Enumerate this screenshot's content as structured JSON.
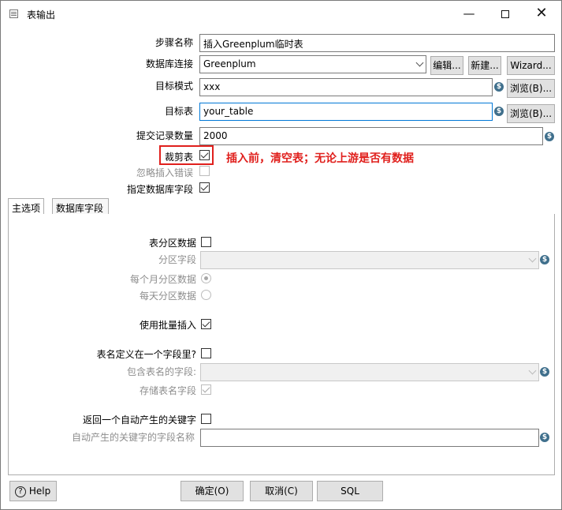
{
  "window": {
    "title": "表输出"
  },
  "form": {
    "step_name_label": "步骤名称",
    "step_name_value": "插入Greenplum临时表",
    "db_conn_label": "数据库连接",
    "db_conn_value": "Greenplum",
    "edit_btn": "编辑...",
    "new_btn": "新建...",
    "wizard_btn": "Wizard...",
    "schema_label": "目标模式",
    "schema_value": "xxx",
    "browse_btn": "浏览(B)...",
    "table_label": "目标表",
    "table_value": "your_table",
    "commit_label": "提交记录数量",
    "commit_value": "2000",
    "truncate_label": "裁剪表",
    "truncate_checked": true,
    "ignore_errors_label": "忽略插入错误",
    "specify_fields_label": "指定数据库字段",
    "annotation": "插入前，清空表；无论上游是否有数据"
  },
  "tabs": [
    {
      "label": "主选项"
    },
    {
      "label": "数据库字段"
    }
  ],
  "main": {
    "partition_label": "表分区数据",
    "partition_field_label": "分区字段",
    "monthly_label": "每个月分区数据",
    "daily_label": "每天分区数据",
    "batch_label": "使用批量插入",
    "tablename_in_field_label": "表名定义在一个字段里?",
    "tablename_field_label": "包含表名的字段:",
    "store_tablename_label": "存储表名字段",
    "return_key_label": "返回一个自动产生的关键字",
    "key_field_label": "自动产生的关键字的字段名称"
  },
  "footer": {
    "help": "Help",
    "ok": "确定(O)",
    "cancel": "取消(C)",
    "sql": "SQL"
  }
}
